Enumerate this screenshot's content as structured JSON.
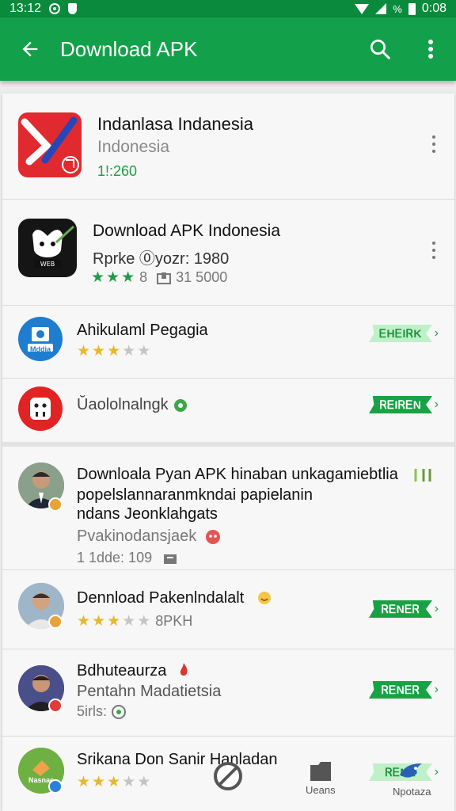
{
  "status_bar": {
    "time": "13:12",
    "percent": "%",
    "clock_right": "0:08",
    "icons": [
      "record-circle-icon",
      "shield-icon",
      "wifi-icon",
      "signal-icon",
      "battery-icon"
    ]
  },
  "app_bar": {
    "title": "Download APK",
    "back_icon": "arrow-back-icon",
    "search_icon": "search-icon",
    "more_icon": "more-vert-icon"
  },
  "colors": {
    "primary": "#13a04a",
    "status": "#0a8a3c",
    "star_green": "#1f9d43",
    "star_gold": "#e8b72c"
  },
  "items": [
    {
      "title": "Indanlasa  Indanesia",
      "subtitle": "Indonesia",
      "meta": "1!:260",
      "icon": "red-pen-app-icon"
    },
    {
      "title": "Download APK Indonesia",
      "subtitle": "Rprke ⓪yozr: 1980",
      "stars": 3,
      "rating_text": "8",
      "size_text": "31 5000",
      "icon": "alien-app-icon"
    },
    {
      "title": "Ahikulaml Pegagia",
      "stars": 3,
      "icon_label": "Mddia",
      "button": "ᎬHᎬIᏒK",
      "icon": "photo-app-icon"
    },
    {
      "title": "Ŭaololnalngk",
      "button": "ᏒᎬIᏒᎬN",
      "icon": "robot-app-icon"
    },
    {
      "title": "Downloala Pyan APK hinaban unkagamiebtlia",
      "line2": "popelslannaranmkndai papielanin",
      "line3": "ndans Jeonklahgats",
      "subtitle": "Pvakinodansjaek",
      "meta": "1 1dde: 109",
      "icon": "avatar-man-1"
    },
    {
      "title": "Dennload Pakenlndalalt",
      "stars": 3,
      "rating_text": "8PKH",
      "button": "ᏒᎬNᎬᏒ",
      "icon": "avatar-man-2"
    },
    {
      "title": "Bdhuteaurza",
      "subtitle": "Pentahn Madatietsia",
      "meta": "5irls:",
      "button": "ᏒᎬNᎬᏒ",
      "icon": "avatar-man-3"
    },
    {
      "title": "Srikana Don  Sanir  Hanladan",
      "stars": 3,
      "icon_label": "Nasnae",
      "button": "ᏒᎬNᎬ",
      "icon": "leaf-app-icon"
    }
  ],
  "bottom_nav": [
    {
      "label": "",
      "icon": "block-icon"
    },
    {
      "label": "Ueans",
      "icon": "folder-icon"
    },
    {
      "label": "Npotaza",
      "icon": "bird-icon"
    }
  ]
}
